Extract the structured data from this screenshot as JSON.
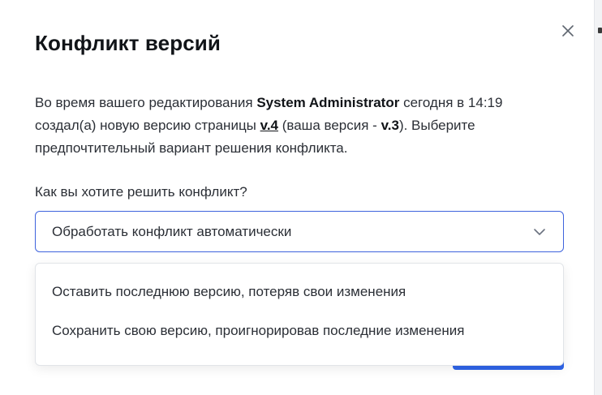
{
  "dialog": {
    "title": "Конфликт версий",
    "message": {
      "part1": "Во время вашего редактирования ",
      "user": "System Administrator",
      "part2": " сегодня в 14:19 создал(а) новую версию страницы ",
      "new_version": "v.4",
      "part3": " (ваша версия - ",
      "your_version": "v.3",
      "part4": "). Выберите предпочтительный вариант решения конфликта."
    },
    "question": "Как вы хотите решить конфликт?",
    "select": {
      "value": "Обработать конфликт автоматически"
    },
    "options": [
      "Оставить последнюю версию, потеряв свои изменения",
      "Сохранить свою версию, проигнорировав последние изменения"
    ]
  },
  "icons": {
    "close": "close-icon",
    "chevron": "chevron-down-icon"
  },
  "colors": {
    "accent": "#3e63dd",
    "primary_button": "#2f64e8",
    "text": "#2b2f36",
    "title": "#111418"
  }
}
